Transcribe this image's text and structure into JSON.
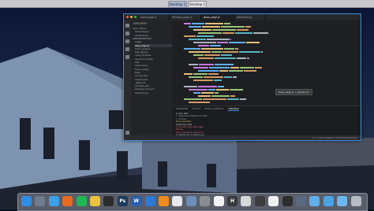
{
  "spaces": {
    "tabs": [
      {
        "label": "Desktop 1",
        "active": true
      },
      {
        "label": "Desktop 2",
        "active": false
      }
    ]
  },
  "editor": {
    "tabs": [
      {
        "label": "base.page.js",
        "active": false
      },
      {
        "label": "Window_page.js",
        "active": false
      },
      {
        "label": "base_page.js",
        "active": true
      },
      {
        "label": "webdriver.js",
        "active": false
      }
    ],
    "sidebar_title": "EXPLORER",
    "sidebar_items": [
      "open editors",
      "base.page.js",
      "webdriver.js",
      "WEBDRIVER-TEST",
      "pages",
      "base_page.js",
      "home_page.js",
      "test_page.js",
      "node_modules",
      "selenium-webdri",
      "test",
      "base.test.js",
      "home_test.js",
      "tests",
      "mocha_test",
      "readme.md",
      ".gitignore",
      "package.json",
      "package-lock.json",
      "webdriver.js"
    ],
    "selected_item_index": 5,
    "tooltip": "base_page.js > webdriver",
    "panel_tabs": [
      "PROBLEMS",
      "OUTPUT",
      "DEBUG CONSOLE",
      "TERMINAL"
    ],
    "active_panel_tab_index": 3,
    "terminal_lines": [
      "$ npm test",
      "> webdriver-test@1.0.0 test",
      "> mocha",
      "Running tests",
      "  webdriver test",
      "    1) should open the page",
      "  failing",
      "    Error: element not found",
      "    at WebDriver.findElement"
    ],
    "status_text": "Ln 1, Col 1  Spaces: 4  UTF-8  LF  JavaScript"
  },
  "dock": {
    "items": [
      {
        "name": "finder-icon",
        "label": "",
        "color": "#2f8de4"
      },
      {
        "name": "launchpad-icon",
        "label": "",
        "color": "#6f7c8e"
      },
      {
        "name": "safari-icon",
        "label": "",
        "color": "#3ca0e8"
      },
      {
        "name": "firefox-icon",
        "label": "",
        "color": "#e66a1f"
      },
      {
        "name": "spotify-icon",
        "label": "",
        "color": "#1db954"
      },
      {
        "name": "chrome-icon",
        "label": "",
        "color": "#e8c33d"
      },
      {
        "name": "terminal-icon",
        "label": "",
        "color": "#2b2b2b"
      },
      {
        "name": "photoshop-icon",
        "label": "Ps",
        "color": "#1c3c5c"
      },
      {
        "name": "word-icon",
        "label": "W",
        "color": "#2b5fae"
      },
      {
        "name": "vscode-icon",
        "label": "",
        "color": "#2c7ad6"
      },
      {
        "name": "vlc-icon",
        "label": "",
        "color": "#f08a1c"
      },
      {
        "name": "itunes-icon",
        "label": "",
        "color": "#e8e8ee"
      },
      {
        "name": "preview-icon",
        "label": "",
        "color": "#6b8fb8"
      },
      {
        "name": "system-preferences-icon",
        "label": "",
        "color": "#8a8d92"
      },
      {
        "name": "calendar-icon",
        "label": "",
        "color": "#f2f2f2"
      },
      {
        "name": "hammer-icon",
        "label": "H",
        "color": "#3a3a3a"
      },
      {
        "name": "notes-icon",
        "label": "",
        "color": "#d8d8d8"
      },
      {
        "name": "activity-monitor-icon",
        "label": "",
        "color": "#3c3c3c"
      },
      {
        "name": "photos-icon",
        "label": "",
        "color": "#f0f0f0"
      },
      {
        "name": "obs-icon",
        "label": "",
        "color": "#2d2d2d"
      },
      {
        "name": "app-icon",
        "label": "",
        "color": "#5a6a80"
      },
      {
        "name": "folder-icon",
        "label": "",
        "color": "#5fb0ea"
      },
      {
        "name": "downloads-folder-icon",
        "label": "",
        "color": "#4aa3e6"
      },
      {
        "name": "documents-folder-icon",
        "label": "",
        "color": "#6bb7ee"
      },
      {
        "name": "trash-icon",
        "label": "",
        "color": "#b8bcc2"
      }
    ]
  }
}
